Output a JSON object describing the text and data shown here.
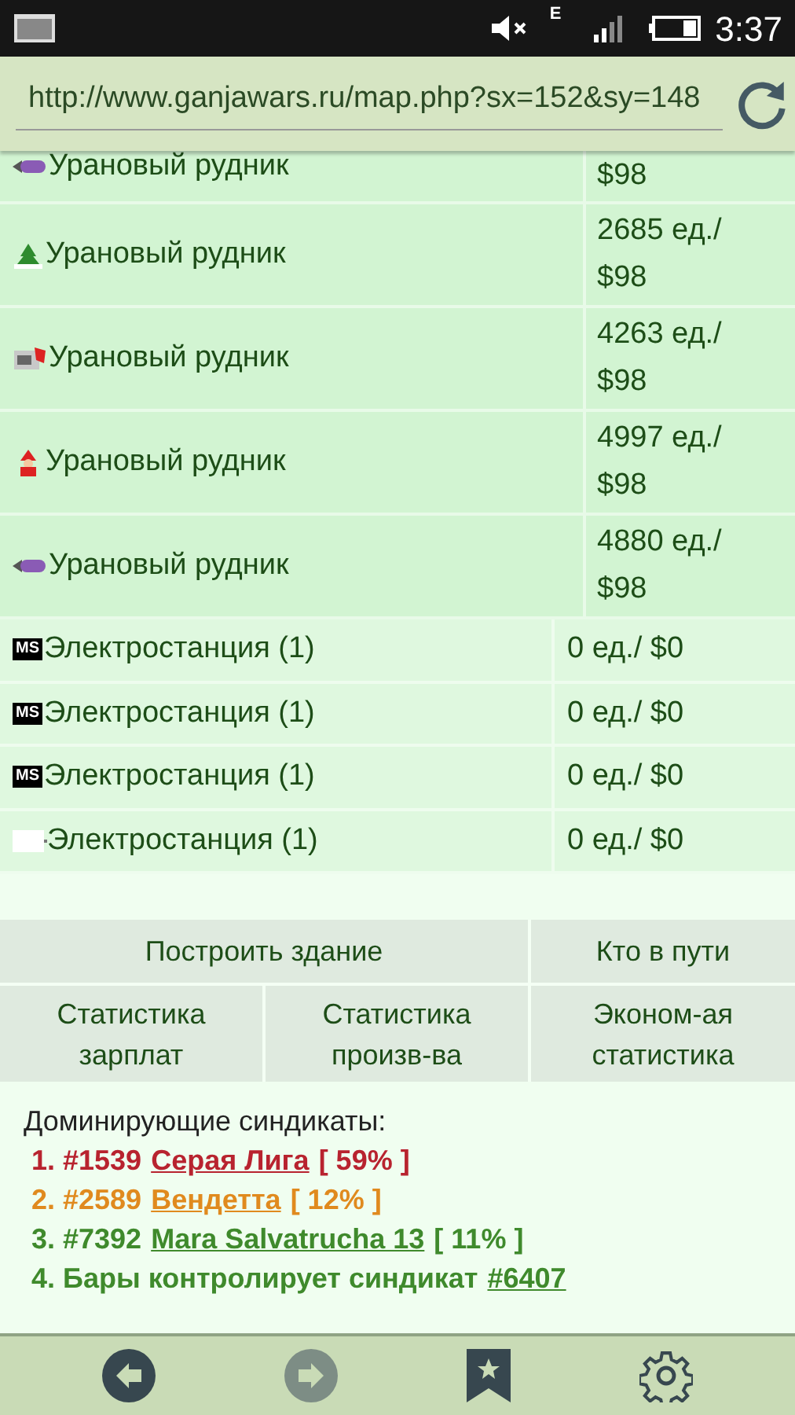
{
  "status_bar": {
    "network": "E",
    "time": "3:37"
  },
  "address_bar": {
    "url": "http://www.ganjawars.ru/map.php?sx=152&sy=148"
  },
  "mines": [
    {
      "name": "Урановый рудник",
      "output": "$98"
    },
    {
      "name": "Урановый рудник",
      "output": "2685 ед./ $98"
    },
    {
      "name": "Урановый рудник",
      "output": "4263 ед./ $98"
    },
    {
      "name": "Урановый рудник",
      "output": "4997 ед./ $98"
    },
    {
      "name": "Урановый рудник",
      "output": "4880 ед./ $98"
    }
  ],
  "plants": [
    {
      "badge": "MS",
      "name": "Электростанция (1)",
      "output": "0 ед./ $0"
    },
    {
      "badge": "MS",
      "name": "Электростанция (1)",
      "output": "0 ед./ $0"
    },
    {
      "badge": "MS",
      "name": "Электростанция (1)",
      "output": "0 ед./ $0"
    },
    {
      "name": "Электростанция (1)",
      "output": "0 ед./ $0"
    }
  ],
  "actions": [
    [
      "Построить здание",
      "Кто в пути"
    ],
    [
      "Статистика зарплат",
      "Статистика произв-ва",
      "Эконом-ая статистика"
    ]
  ],
  "syndicates": {
    "title": "Доминирующие синдикаты:",
    "items": [
      {
        "kind": "ranked",
        "prefix": "1. #1539",
        "link": "Серая Лига",
        "share": "[ 59% ]",
        "color": "#b8232f"
      },
      {
        "kind": "ranked",
        "prefix": "2. #2589",
        "link": "Вендетта",
        "share": "[ 12% ]",
        "color": "#e08a1e"
      },
      {
        "kind": "ranked",
        "prefix": "3. #7392",
        "link": "Mara Salvatrucha 13",
        "share": "[ 11% ]",
        "color": "#3f8a2c"
      },
      {
        "kind": "bars",
        "prefix": "4. Бары контролирует синдикат",
        "link": "#6407",
        "color": "#3f8a2c"
      }
    ]
  }
}
